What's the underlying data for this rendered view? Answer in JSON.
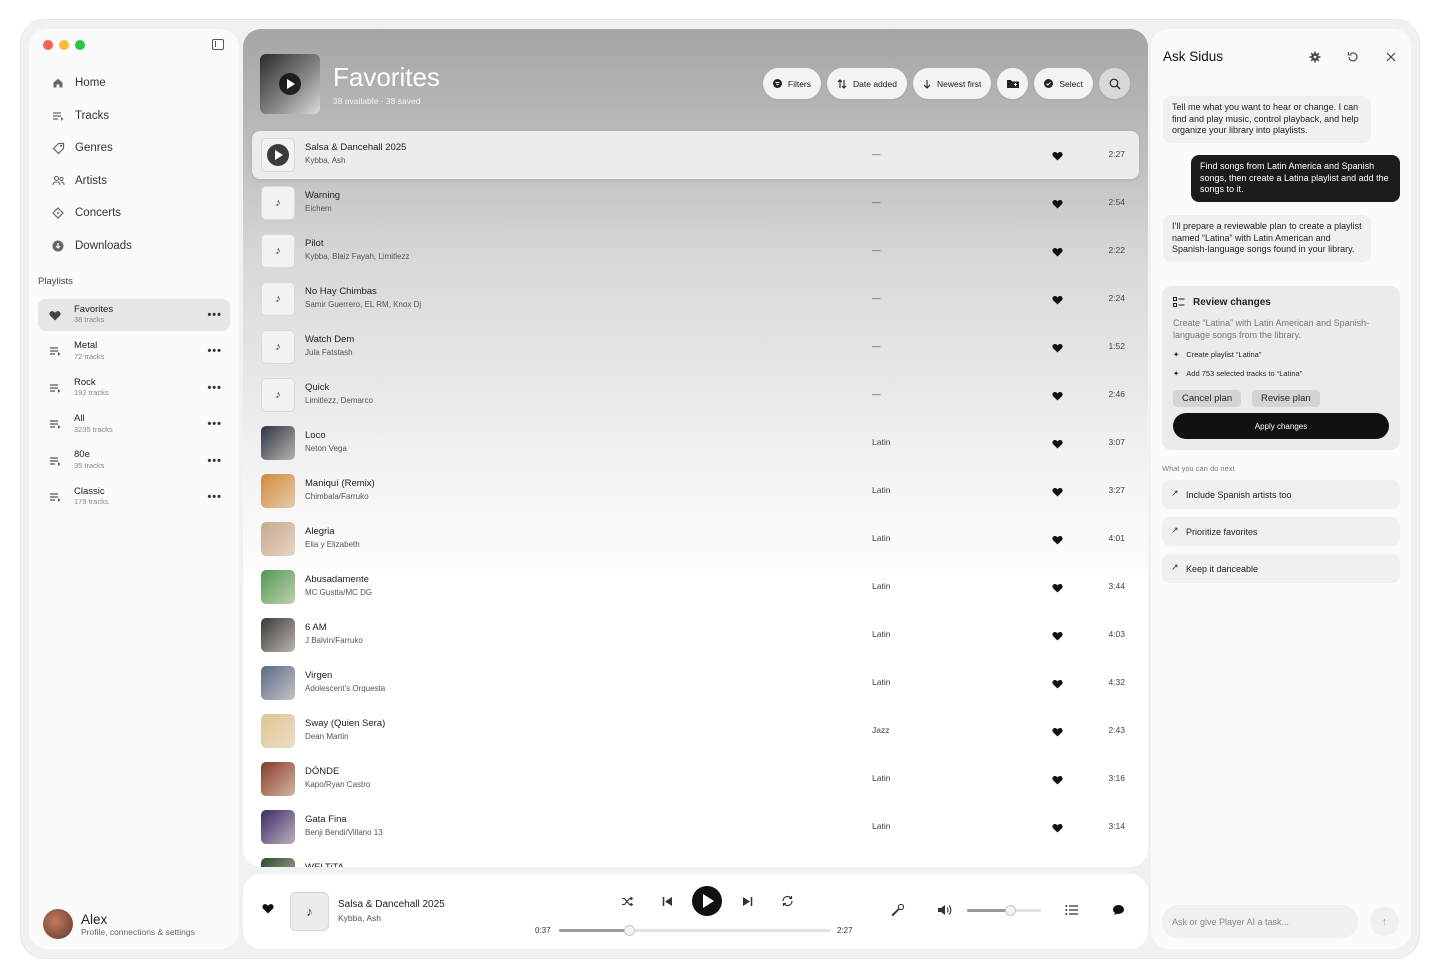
{
  "sidebar": {
    "nav": [
      {
        "label": "Home",
        "icon": "home-icon"
      },
      {
        "label": "Tracks",
        "icon": "list-icon"
      },
      {
        "label": "Genres",
        "icon": "tag-icon"
      },
      {
        "label": "Artists",
        "icon": "people-icon"
      },
      {
        "label": "Concerts",
        "icon": "ticket-icon"
      },
      {
        "label": "Downloads",
        "icon": "download-icon"
      }
    ],
    "playlists_label": "Playlists",
    "playlists": [
      {
        "name": "Favorites",
        "count": "38 tracks",
        "icon": "heart-icon",
        "active": true
      },
      {
        "name": "Metal",
        "count": "72 tracks",
        "icon": "playlist-icon"
      },
      {
        "name": "Rock",
        "count": "192 tracks",
        "icon": "playlist-icon"
      },
      {
        "name": "All",
        "count": "3235 tracks",
        "icon": "playlist-icon"
      },
      {
        "name": "80e",
        "count": "35 tracks",
        "icon": "playlist-icon"
      },
      {
        "name": "Classic",
        "count": "179 tracks",
        "icon": "playlist-icon"
      }
    ],
    "more_label": "•••",
    "profile": {
      "name": "Alex",
      "sub": "Profile, connections & settings"
    }
  },
  "header": {
    "title": "Favorites",
    "subtitle": "38 available · 38 saved",
    "toolbar": {
      "filters": "Filters",
      "sort": "Date added",
      "order": "Newest first",
      "select": "Select"
    }
  },
  "tracks": [
    {
      "title": "Salsa & Dancehall 2025",
      "artist": "Kybba, Ash",
      "genre": "—",
      "duration": "2:27",
      "thumb": "playing",
      "active": true
    },
    {
      "title": "Warning",
      "artist": "Eichem",
      "genre": "—",
      "duration": "2:54",
      "thumb": "note"
    },
    {
      "title": "Pilot",
      "artist": "Kybba, Blaiz Fayah, Limitlezz",
      "genre": "—",
      "duration": "2:22",
      "thumb": "note"
    },
    {
      "title": "No Hay Chimbas",
      "artist": "Samir Guerrero, EL RM, Knox Dj",
      "genre": "—",
      "duration": "2:24",
      "thumb": "note"
    },
    {
      "title": "Watch Dem",
      "artist": "Jula Fatstash",
      "genre": "—",
      "duration": "1:52",
      "thumb": "note"
    },
    {
      "title": "Quick",
      "artist": "Limitlezz, Demarco",
      "genre": "—",
      "duration": "2:46",
      "thumb": "note"
    },
    {
      "title": "Loco",
      "artist": "Neton Vega",
      "genre": "Latin",
      "duration": "3:07",
      "thumb": "art",
      "color": "#2c3444"
    },
    {
      "title": "Maniquí (Remix)",
      "artist": "Chimbala/Farruko",
      "genre": "Latin",
      "duration": "3:27",
      "thumb": "art",
      "color": "#d08a3a"
    },
    {
      "title": "Alegria",
      "artist": "Elia y Elizabeth",
      "genre": "Latin",
      "duration": "4:01",
      "thumb": "art",
      "color": "#c9a98e"
    },
    {
      "title": "Abusadamente",
      "artist": "MC Gustta/MC DG",
      "genre": "Latin",
      "duration": "3:44",
      "thumb": "art",
      "color": "#4f9a4e"
    },
    {
      "title": "6 AM",
      "artist": "J Balvin/Farruko",
      "genre": "Latin",
      "duration": "4:03",
      "thumb": "art",
      "color": "#3a3a3a"
    },
    {
      "title": "Virgen",
      "artist": "Adolescent's Orquesta",
      "genre": "Latin",
      "duration": "4:32",
      "thumb": "art",
      "color": "#5a6a88"
    },
    {
      "title": "Sway (Quien Sera)",
      "artist": "Dean Martin",
      "genre": "Jazz",
      "duration": "2:43",
      "thumb": "art",
      "color": "#e0c590"
    },
    {
      "title": "DÓNDE",
      "artist": "Kapo/Ryan Castro",
      "genre": "Latin",
      "duration": "3:16",
      "thumb": "art",
      "color": "#8a3a22"
    },
    {
      "title": "Gata Fina",
      "artist": "Benji Bendi/Villano 13",
      "genre": "Latin",
      "duration": "3:14",
      "thumb": "art",
      "color": "#3a2a6a"
    },
    {
      "title": "WELTiTA",
      "artist": "",
      "genre": "",
      "duration": "",
      "thumb": "art",
      "color": "#2a4a2a"
    }
  ],
  "player": {
    "title": "Salsa & Dancehall 2025",
    "artist": "Kybba, Ash",
    "elapsed": "0:37",
    "total": "2:27",
    "progress": 0.26,
    "volume": 0.6
  },
  "assistant": {
    "title": "Ask Sidus",
    "messages": [
      {
        "role": "ai",
        "text": "Tell me what you want to hear or change. I can find and play music, control playback, and help organize your library into playlists."
      },
      {
        "role": "user",
        "text": "Find songs from Latin America and Spanish songs, then create a Latina playlist and add the songs to it."
      },
      {
        "role": "ai",
        "text": "I’ll prepare a reviewable plan to create a playlist named “Latina” with Latin American and Spanish-language songs found in your library."
      }
    ],
    "review": {
      "title": "Review changes",
      "description": "Create “Latina” with Latin American and Spanish-language songs from the library.",
      "steps": [
        "Create playlist “Latina”",
        "Add 753 selected tracks to “Latina”"
      ],
      "cancel": "Cancel plan",
      "revise": "Revise plan",
      "apply": "Apply changes"
    },
    "next_label": "What you can do next",
    "suggestions": [
      "Include Spanish artists too",
      "Prioritize favorites",
      "Keep it danceable"
    ],
    "input_placeholder": "Ask or give Player AI a task..."
  }
}
